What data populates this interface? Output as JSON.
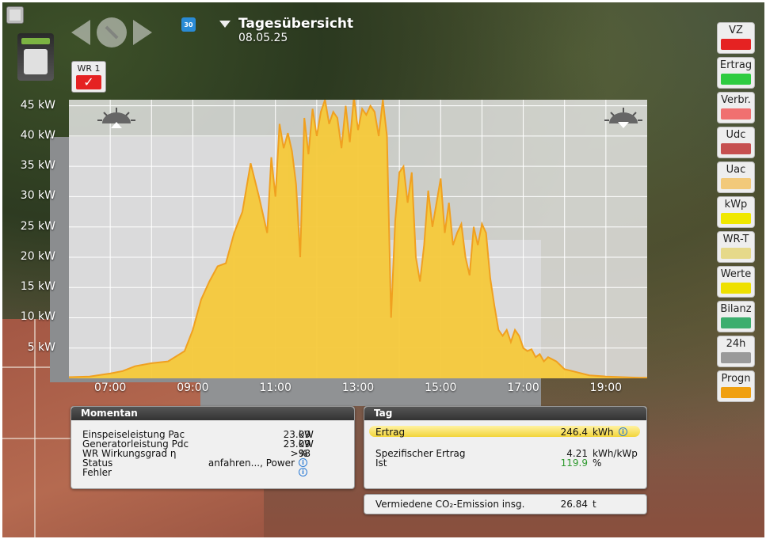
{
  "header": {
    "title": "Tagesübersicht",
    "date": "08.05.25",
    "calendar_label": "30"
  },
  "inverter": {
    "label": "WR 1",
    "checked_icon": "checkmark-icon"
  },
  "chart_data": {
    "type": "area",
    "y_ticks": [
      "5 kW",
      "10 kW",
      "15 kW",
      "20 kW",
      "25 kW",
      "30 kW",
      "35 kW",
      "40 kW",
      "45 kW"
    ],
    "x_ticks": [
      "07:00",
      "09:00",
      "11:00",
      "13:00",
      "15:00",
      "17:00",
      "19:00"
    ],
    "ylim": [
      0,
      46
    ],
    "xlim": [
      6.0,
      20.0
    ],
    "series": [
      {
        "color": "#f5c93a",
        "x": [
          6.0,
          6.5,
          7.0,
          7.3,
          7.6,
          8.0,
          8.4,
          8.8,
          9.0,
          9.2,
          9.4,
          9.6,
          9.8,
          10.0,
          10.2,
          10.4,
          10.6,
          10.8,
          10.9,
          11.0,
          11.1,
          11.2,
          11.3,
          11.4,
          11.5,
          11.6,
          11.7,
          11.8,
          11.9,
          12.0,
          12.1,
          12.2,
          12.3,
          12.4,
          12.5,
          12.6,
          12.7,
          12.8,
          12.9,
          13.0,
          13.1,
          13.2,
          13.3,
          13.4,
          13.5,
          13.6,
          13.7,
          13.8,
          13.9,
          14.0,
          14.1,
          14.2,
          14.3,
          14.4,
          14.5,
          14.6,
          14.7,
          14.8,
          14.9,
          15.0,
          15.1,
          15.2,
          15.3,
          15.4,
          15.5,
          15.6,
          15.7,
          15.8,
          15.9,
          16.0,
          16.1,
          16.2,
          16.3,
          16.4,
          16.5,
          16.6,
          16.7,
          16.8,
          16.9,
          17.0,
          17.1,
          17.2,
          17.3,
          17.4,
          17.5,
          17.6,
          17.8,
          18.0,
          18.3,
          18.6,
          19.0,
          19.4,
          19.8,
          20.0
        ],
        "y": [
          0.2,
          0.3,
          0.8,
          1.2,
          2.0,
          2.5,
          2.8,
          4.5,
          8.0,
          13.0,
          16.0,
          18.5,
          19.0,
          24.0,
          27.5,
          35.5,
          30.0,
          24.0,
          36.5,
          30.0,
          42.0,
          38.0,
          40.5,
          37.5,
          32.0,
          20.0,
          43.0,
          37.0,
          44.5,
          40.0,
          44.0,
          46.0,
          42.0,
          44.0,
          43.0,
          38.0,
          45.0,
          39.0,
          46.5,
          41.0,
          44.5,
          43.5,
          45.0,
          44.0,
          40.0,
          46.0,
          40.0,
          10.0,
          26.0,
          34.0,
          35.0,
          29.0,
          34.0,
          20.0,
          16.0,
          22.0,
          31.0,
          25.0,
          29.0,
          33.0,
          24.0,
          29.0,
          22.0,
          24.0,
          25.5,
          20.0,
          17.0,
          25.0,
          22.0,
          25.5,
          24.0,
          16.5,
          12.0,
          8.0,
          7.0,
          8.0,
          6.0,
          8.0,
          7.0,
          5.0,
          4.5,
          4.8,
          3.5,
          4.0,
          2.8,
          3.5,
          2.8,
          1.5,
          1.0,
          0.5,
          0.3,
          0.2,
          0.1,
          0.1
        ]
      }
    ],
    "grid": true
  },
  "side_buttons": [
    {
      "label": "VZ",
      "color": "#e52222"
    },
    {
      "label": "Ertrag",
      "color": "#2ecc40"
    },
    {
      "label": "Verbr.",
      "color": "#f07070"
    },
    {
      "label": "Udc",
      "color": "#c65050"
    },
    {
      "label": "Uac",
      "color": "#f2c97a"
    },
    {
      "label": "kWp",
      "color": "#f0e800"
    },
    {
      "label": "WR-T",
      "color": "#e6d98a"
    },
    {
      "label": "Werte",
      "color": "#eee000"
    },
    {
      "label": "Bilanz",
      "color": "#3cae6e"
    },
    {
      "label": "24h",
      "color": "#9a9a9a"
    },
    {
      "label": "Progn",
      "color": "#f0a010"
    }
  ],
  "momentan": {
    "title": "Momentan",
    "rows": [
      {
        "label": "Einspeiseleistung Pac",
        "value": "23.09",
        "unit": "kW"
      },
      {
        "label": "Generatorleistung Pdc",
        "value": "23.09",
        "unit": "kW"
      },
      {
        "label": "WR Wirkungsgrad η",
        "value": ">98",
        "unit": "%"
      },
      {
        "label": "Status",
        "value": "anfahren..., Power",
        "unit": ""
      },
      {
        "label": "Fehler",
        "value": "",
        "unit": ""
      }
    ]
  },
  "tag": {
    "title": "Tag",
    "ertrag": {
      "label": "Ertrag",
      "value": "246.4",
      "unit": "kWh"
    },
    "spez": {
      "label": "Spezifischer Ertrag",
      "value": "4.21",
      "unit": "kWh/kWp"
    },
    "ist": {
      "label": "Ist",
      "value": "119.9",
      "unit": "%"
    }
  },
  "co2": {
    "label": "Vermiedene CO₂-Emission insg.",
    "value": "26.84",
    "unit": "t"
  }
}
